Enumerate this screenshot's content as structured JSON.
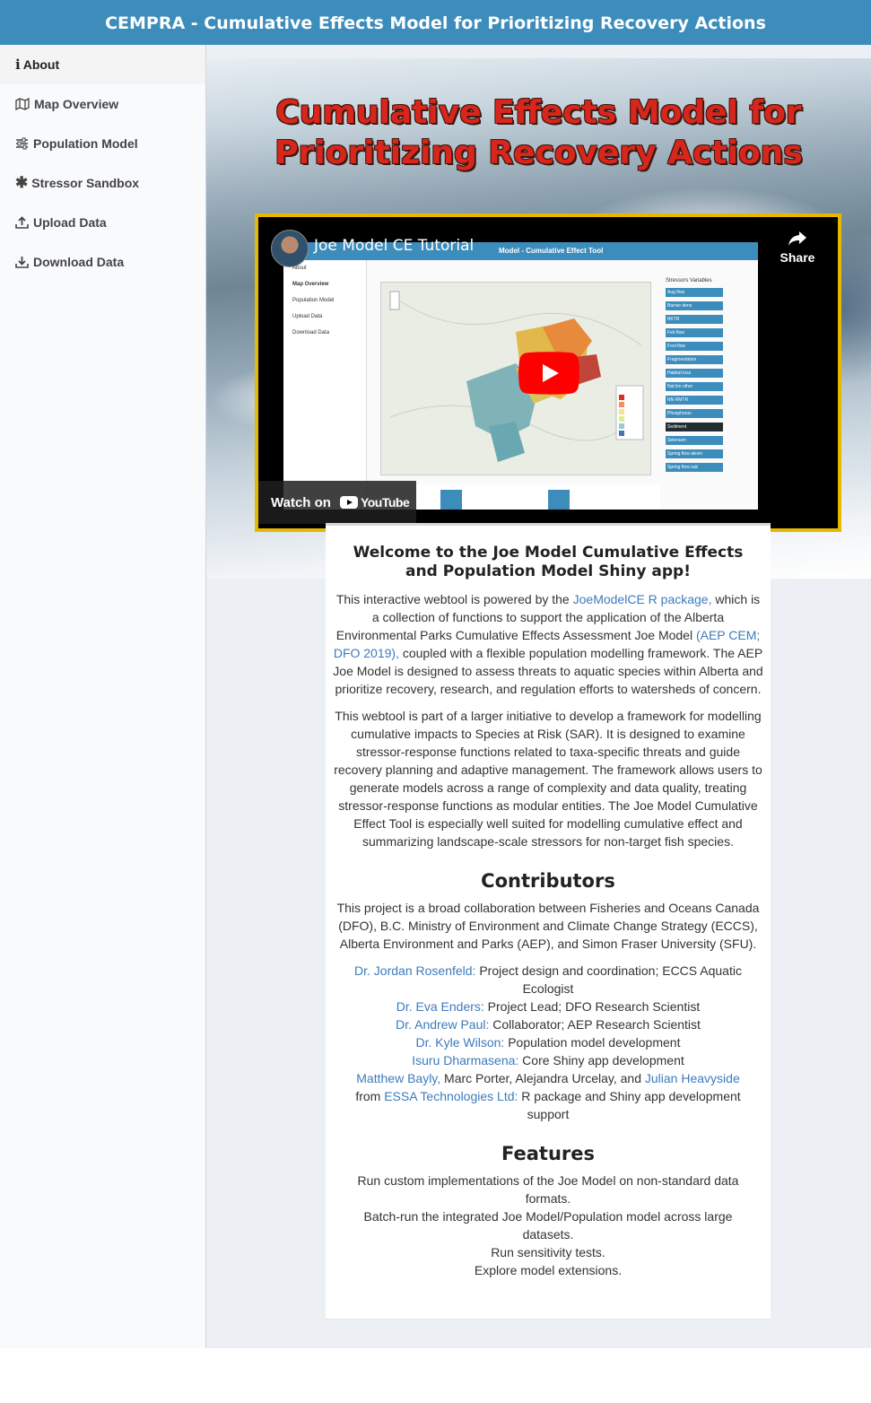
{
  "header": {
    "title": "CEMPRA - Cumulative Effects Model for Prioritizing Recovery Actions"
  },
  "sidebar": {
    "items": [
      {
        "label": "About",
        "icon": "info-icon"
      },
      {
        "label": "Map Overview",
        "icon": "map-icon"
      },
      {
        "label": "Population Model",
        "icon": "sliders-icon"
      },
      {
        "label": "Stressor Sandbox",
        "icon": "asterisk-icon"
      },
      {
        "label": "Upload Data",
        "icon": "upload-icon"
      },
      {
        "label": "Download Data",
        "icon": "download-icon"
      }
    ]
  },
  "hero": {
    "title_line1": "Cumulative Effects Model for",
    "title_line2": "Prioritizing Recovery Actions"
  },
  "video": {
    "title": "Joe Model CE Tutorial",
    "share_label": "Share",
    "watch_on": "Watch on",
    "youtube_label": "YouTube",
    "embedded_header": "Model - Cumulative Effect Tool",
    "embedded_sidebar": [
      "About",
      "Map Overview",
      "Population Model",
      "Upload Data",
      "Download Data"
    ],
    "embedded_panel_title": "Stressors Variables",
    "embedded_buttons": [
      "Aug flow",
      "Barrier dens",
      "BKTR",
      "Feb flow",
      "Fool flow",
      "Fragmentation",
      "Habitat loss",
      "Nat lim other",
      "NN RMTR",
      "Phosphorus",
      "Sediment",
      "Selenium",
      "Spring flow alevin",
      "Spring flow sub"
    ]
  },
  "welcome": {
    "heading": "Welcome to the Joe Model Cumulative Effects and Population Model Shiny app!",
    "p1_a": "This interactive webtool is powered by the ",
    "p1_link1": "JoeModelCE R package,",
    "p1_b": " which is a collection of functions to support the application of the Alberta Environmental Parks Cumulative Effects Assessment Joe Model ",
    "p1_link2": "(AEP CEM; DFO 2019),",
    "p1_c": " coupled with a flexible population modelling framework. The AEP Joe Model is designed to assess threats to aquatic species within Alberta and prioritize recovery, research, and regulation efforts to watersheds of concern.",
    "p2": "This webtool is part of a larger initiative to develop a framework for modelling cumulative impacts to Species at Risk (SAR). It is designed to examine stressor-response functions related to taxa-specific threats and guide recovery planning and adaptive management. The framework allows users to generate models across a range of complexity and data quality, treating stressor-response functions as modular entities. The Joe Model Cumulative Effect Tool is especially well suited for modelling cumulative effect and summarizing landscape-scale stressors for non-target fish species."
  },
  "contributors": {
    "heading": "Contributors",
    "intro": "This project is a broad collaboration between Fisheries and Oceans Canada (DFO), B.C. Ministry of Environment and Climate Change Strategy (ECCS), Alberta Environment and Parks (AEP), and Simon Fraser University (SFU).",
    "c1_name": "Dr. Jordan Rosenfeld:",
    "c1_role": " Project design and coordination; ECCS Aquatic Ecologist",
    "c2_name": "Dr. Eva Enders:",
    "c2_role": " Project Lead; DFO Research Scientist",
    "c3_name": "Dr. Andrew Paul:",
    "c3_role": " Collaborator; AEP Research Scientist",
    "c4_name": "Dr. Kyle Wilson:",
    "c4_role": " Population model development",
    "c5_name": "Isuru Dharmasena:",
    "c5_role": " Core Shiny app development",
    "c6_name": "Matthew Bayly,",
    "c6_mid": " Marc Porter, Alejandra Urcelay, and ",
    "c6_name2": "Julian Heavyside",
    "c6_from": "from ",
    "c6_org": "ESSA Technologies Ltd:",
    "c6_role": " R package and Shiny app development support"
  },
  "features": {
    "heading": "Features",
    "items": [
      "Run custom implementations of the Joe Model on non-standard data formats.",
      "Batch-run the integrated Joe Model/Population model across large datasets.",
      "Run sensitivity tests.",
      "Explore model extensions."
    ]
  },
  "colors": {
    "header_bg": "#3c8dbc",
    "link": "#3c7bbd",
    "video_border": "#e6b800",
    "hero_title": "#d9261c"
  }
}
